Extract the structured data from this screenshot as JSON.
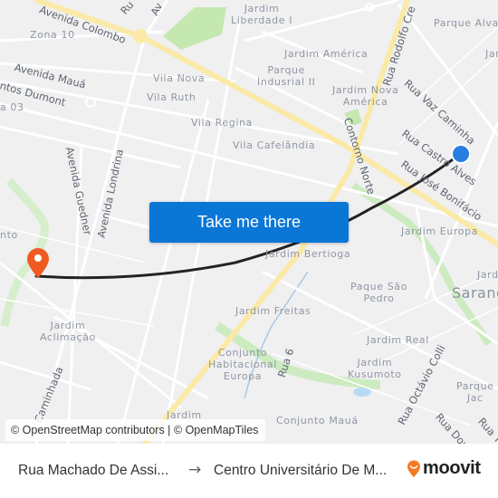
{
  "map": {
    "neighborhoods": [
      {
        "id": "zona-10",
        "text": "Zona 10"
      },
      {
        "id": "jardim-liberdade",
        "text": "Jardim\nLiberdade I"
      },
      {
        "id": "parque-alvamar",
        "text": "Parque Alva"
      },
      {
        "id": "jardim-america",
        "text": "Jardim América"
      },
      {
        "id": "parque-industrial",
        "text": "Parque\nIndusrial II"
      },
      {
        "id": "jardim-nova-america",
        "text": "Jardim Nova\nAmérica"
      },
      {
        "id": "vila-nova",
        "text": "Vila Nova"
      },
      {
        "id": "vila-ruth",
        "text": "Vila Ruth"
      },
      {
        "id": "vila-regina",
        "text": "Vila Regina"
      },
      {
        "id": "vila-cafelandia",
        "text": "Vila Cafelândia"
      },
      {
        "id": "zona-03",
        "text": "a 03"
      },
      {
        "id": "jardim-europa",
        "text": "Jardim Europa"
      },
      {
        "id": "jardim-bertioga",
        "text": "Jardim Bertioga"
      },
      {
        "id": "paque-sao-pedro",
        "text": "Paque São\nPedro"
      },
      {
        "id": "sarandi",
        "text": "Sarand"
      },
      {
        "id": "jard-right",
        "text": "Jard"
      },
      {
        "id": "jardim-freitas",
        "text": "Jardim Freitas"
      },
      {
        "id": "jardim-real",
        "text": "Jardim Real"
      },
      {
        "id": "conjunto-habitacional-europa",
        "text": "Conjunto\nHabitacional\nEuropa"
      },
      {
        "id": "jardim-kusumoto",
        "text": "Jardim\nKusumoto"
      },
      {
        "id": "jardim-aclimacao",
        "text": "Jardim\nAclimação"
      },
      {
        "id": "parque-jac",
        "text": "Parque\nJac"
      },
      {
        "id": "conjunto-maua",
        "text": "Conjunto Mauá"
      },
      {
        "id": "jardim-bottom",
        "text": "Jardim"
      },
      {
        "id": "nto-left",
        "text": "nto"
      },
      {
        "id": "jar-top-right",
        "text": "Jar"
      }
    ],
    "streets": [
      {
        "id": "avenida-colombo",
        "text": "Avenida Colombo"
      },
      {
        "id": "avenida-maua",
        "text": "Avenida Mauá"
      },
      {
        "id": "santos-dumont",
        "text": "ntos Dumont"
      },
      {
        "id": "rua-rodolfo-cremm",
        "text": "Rua Rodolfo Cre"
      },
      {
        "id": "rua-vaz-caminha",
        "text": "Rua Vaz Caminha"
      },
      {
        "id": "rua-castro-alves",
        "text": "Rua Castro Alves"
      },
      {
        "id": "rua-jose-bonifacio",
        "text": "Rua José Bonifácio"
      },
      {
        "id": "contorno-norte",
        "text": "Contorno Norte"
      },
      {
        "id": "avenida-guedner",
        "text": "Avenida Guedner"
      },
      {
        "id": "avenida-londrina",
        "text": "Avenida Londrina"
      },
      {
        "id": "rua-caminhada",
        "text": "Caminhada"
      },
      {
        "id": "rua-6",
        "text": "Rua 6"
      },
      {
        "id": "rua-octavio-colli",
        "text": "Rua Octávio Colli"
      },
      {
        "id": "rua-dourada",
        "text": "Rua Doura"
      },
      {
        "id": "rua-t",
        "text": "Rua T"
      },
      {
        "id": "rua-top-1",
        "text": "Ru"
      },
      {
        "id": "rua-top-2",
        "text": "Av"
      }
    ],
    "origin_marker": {
      "label": "origin",
      "color": "#2a7de1"
    },
    "destination_marker": {
      "label": "destination",
      "color": "#f15a22"
    },
    "route_color": "#222222",
    "cta_button": {
      "label": "Take me there",
      "color": "#0a76d6"
    },
    "attribution": "© OpenStreetMap contributors | © OpenMapTiles"
  },
  "footer": {
    "origin": "Rua Machado De Assi...",
    "arrow_icon": "→",
    "destination": "Centro Universitário De M...",
    "logo_text": "moovit",
    "logo_color": "#f47a20"
  }
}
